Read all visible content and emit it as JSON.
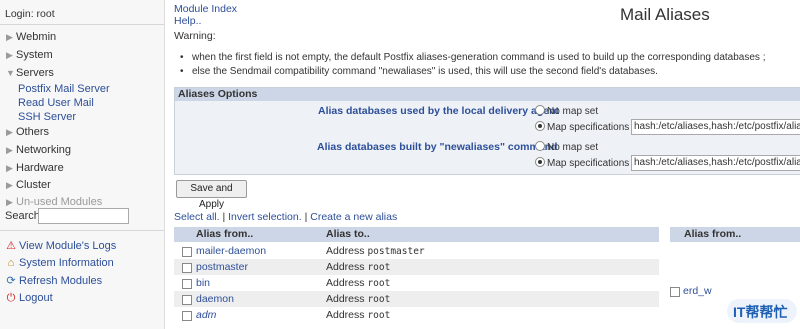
{
  "sidebar": {
    "login": "Login: root",
    "categories": [
      {
        "label": "Webmin"
      },
      {
        "label": "System"
      },
      {
        "label": "Servers"
      },
      {
        "label": "Others"
      },
      {
        "label": "Networking"
      },
      {
        "label": "Hardware"
      },
      {
        "label": "Cluster"
      },
      {
        "label": "Un-used Modules"
      }
    ],
    "servers_items": [
      "Postfix Mail Server",
      "Read User Mail",
      "SSH Server"
    ],
    "search_label": "Search:",
    "links": [
      {
        "label": "View Module's Logs",
        "icon": "warning-icon"
      },
      {
        "label": "System Information",
        "icon": "home-icon"
      },
      {
        "label": "Refresh Modules",
        "icon": "refresh-icon"
      },
      {
        "label": "Logout",
        "icon": "logout-icon"
      }
    ]
  },
  "header": {
    "module_index": "Module Index",
    "help": "Help..",
    "title": "Mail Aliases"
  },
  "warning": {
    "label": "Warning:",
    "items": [
      "when the first field is not empty, the default Postfix aliases-generation command is used to build up the corresponding databases ;",
      "else the Sendmail compatibility command \"newaliases\" is used, this will use the second field's databases."
    ]
  },
  "options": {
    "header": "Aliases Options",
    "local_label": "Alias databases used by the local delivery agent",
    "newaliases_label": "Alias databases built by \"newaliases\" command",
    "no_map": "No map set",
    "map_spec": "Map specifications",
    "local_value": "hash:/etc/aliases,hash:/etc/postfix/aliases",
    "newaliases_value": "hash:/etc/aliases,hash:/etc/postfix/aliases"
  },
  "save_button": "Save and Apply",
  "actions": {
    "select_all": "Select all.",
    "invert": "Invert selection.",
    "create": "Create a new alias",
    "sep": "|"
  },
  "table": {
    "col_from": "Alias from..",
    "col_to": "Alias to..",
    "rows": [
      {
        "from": "mailer-daemon",
        "prefix": "Address",
        "to": "postmaster"
      },
      {
        "from": "postmaster",
        "prefix": "Address",
        "to": "root"
      },
      {
        "from": "bin",
        "prefix": "Address",
        "to": "root"
      },
      {
        "from": "daemon",
        "prefix": "Address",
        "to": "root"
      },
      {
        "from": "adm",
        "prefix": "Address",
        "to": "root"
      }
    ]
  },
  "table2": {
    "col_from": "Alias from..",
    "rows": [
      {
        "from": "erd_w"
      }
    ]
  },
  "watermark": {
    "text": "IT帮帮忙"
  }
}
